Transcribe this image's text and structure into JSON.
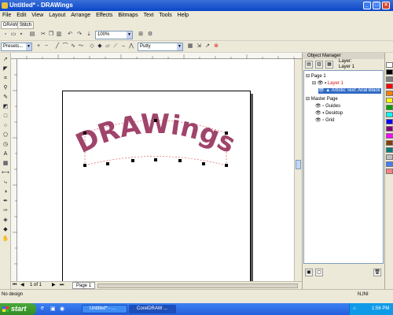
{
  "window": {
    "title": "Untitled* - DRAWings"
  },
  "menu": [
    "File",
    "Edit",
    "View",
    "Layout",
    "Arrange",
    "Effects",
    "Bitmaps",
    "Text",
    "Tools",
    "Help"
  ],
  "tabs": [
    "DRAW",
    "Stitch"
  ],
  "toolbar": {
    "zoom": "100%"
  },
  "property_bar": {
    "presets": "Presets...",
    "style": "Putty"
  },
  "artwork": {
    "text": "DRAWings",
    "color": "#a0446b"
  },
  "object_manager": {
    "title": "Object Manager",
    "layer_label": "Layer:",
    "current_layer": "Layer 1",
    "page": "Page 1",
    "layer": "Layer 1",
    "object": "Artistic Text: Arial Black",
    "master_page": "Master Page",
    "master_layers": [
      "Guides",
      "Desktop",
      "Grid"
    ]
  },
  "page_nav": {
    "page_count": "1 of 1",
    "page_tab": "Page 1"
  },
  "status": {
    "left": "No design",
    "right": "N,INI"
  },
  "taskbar": {
    "start": "start",
    "tasks": [
      "Untitled* - ...",
      "CorelDRAW ..."
    ],
    "clock": "1:56 PM"
  },
  "colors": {
    "accent": "#0a46c8",
    "selection": "#316ac5",
    "layer_red": "#d81010"
  },
  "palette": [
    "#ffffff",
    "#000000",
    "#808080",
    "#ff0000",
    "#ff8000",
    "#ffff00",
    "#00a000",
    "#00ffff",
    "#0000ff",
    "#800080",
    "#ff00ff",
    "#804000",
    "#008080",
    "#c0c0c0",
    "#4080ff",
    "#ff8080"
  ]
}
